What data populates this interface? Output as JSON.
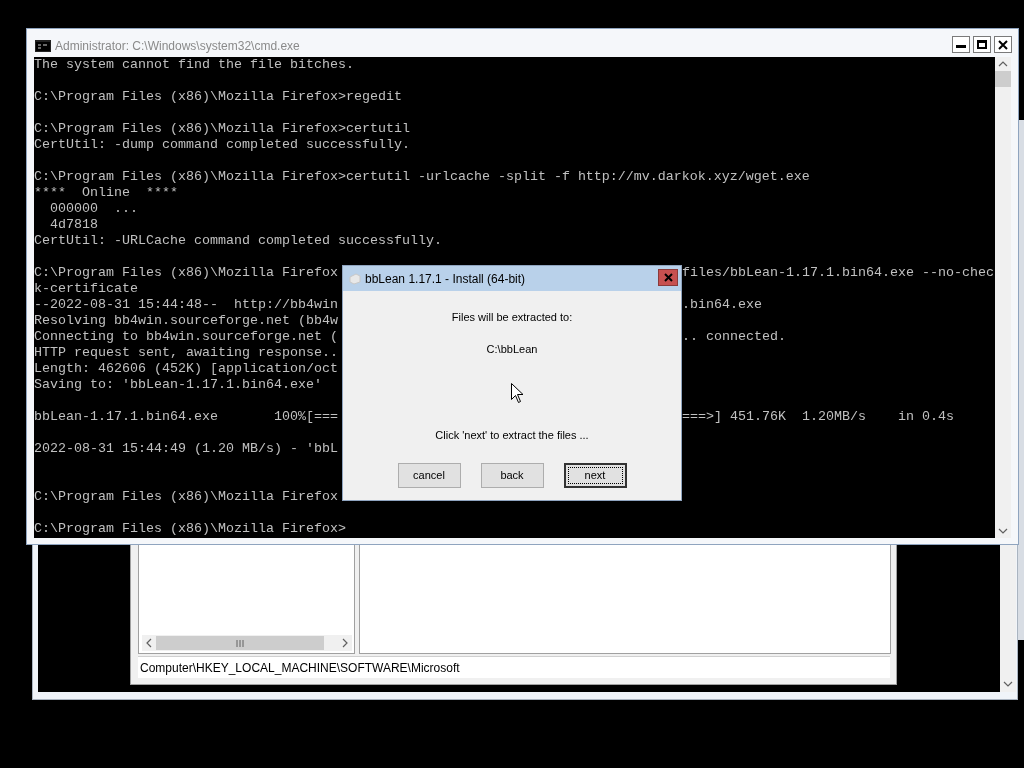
{
  "console_window": {
    "title": "Administrator: C:\\Windows\\system32\\cmd.exe",
    "lines": [
      {
        "kind": "text",
        "text": "The system cannot find the file bitches."
      },
      {
        "kind": "blank"
      },
      {
        "kind": "text",
        "text": "C:\\Program Files (x86)\\Mozilla Firefox>regedit"
      },
      {
        "kind": "blank"
      },
      {
        "kind": "text",
        "text": "C:\\Program Files (x86)\\Mozilla Firefox>certutil"
      },
      {
        "kind": "text",
        "text": "CertUtil: -dump command completed successfully."
      },
      {
        "kind": "blank"
      },
      {
        "kind": "text",
        "text": "C:\\Program Files (x86)\\Mozilla Firefox>certutil -urlcache -split -f http://mv.darkok.xyz/wget.exe"
      },
      {
        "kind": "text",
        "text": "****  Online  ****"
      },
      {
        "kind": "text",
        "text": "  000000  ..."
      },
      {
        "kind": "text",
        "text": "  4d7818"
      },
      {
        "kind": "text",
        "text": "CertUtil: -URLCache command completed successfully."
      },
      {
        "kind": "blank"
      },
      {
        "kind": "text",
        "text": "C:\\Program Files (x86)\\Mozilla Firefox",
        "tail": "files/bbLean-1.17.1.bin64.exe --no-chec"
      },
      {
        "kind": "text",
        "text": "k-certificate"
      },
      {
        "kind": "text",
        "text": "--2022-08-31 15:44:48--  http://bb4win",
        "tail": ".bin64.exe"
      },
      {
        "kind": "text",
        "text": "Resolving bb4win.sourceforge.net (bb4w"
      },
      {
        "kind": "text",
        "text": "Connecting to bb4win.sourceforge.net (",
        "tail": ".. connected."
      },
      {
        "kind": "text",
        "text": "HTTP request sent, awaiting response.."
      },
      {
        "kind": "text",
        "text": "Length: 462606 (452K) [application/oct"
      },
      {
        "kind": "text",
        "text": "Saving to: 'bbLean-1.17.1.bin64.exe'"
      },
      {
        "kind": "blank"
      },
      {
        "kind": "text",
        "text": "bbLean-1.17.1.bin64.exe       100%[===",
        "tail": "===>] 451.76K  1.20MB/s    in 0.4s"
      },
      {
        "kind": "blank"
      },
      {
        "kind": "text",
        "text": "2022-08-31 15:44:49 (1.20 MB/s) - 'bbL"
      },
      {
        "kind": "blank"
      },
      {
        "kind": "blank"
      },
      {
        "kind": "text",
        "text": "C:\\Program Files (x86)\\Mozilla Firefox"
      },
      {
        "kind": "blank"
      },
      {
        "kind": "text",
        "text": "C:\\Program Files (x86)\\Mozilla Firefox>"
      }
    ]
  },
  "installer_dialog": {
    "title": "bbLean 1.17.1 - Install (64-bit)",
    "message": "Files will be extracted to:",
    "path": "C:\\bbLean",
    "instruction": "Click 'next' to extract the files ...",
    "buttons": [
      {
        "label": "cancel",
        "default": false
      },
      {
        "label": "back",
        "default": false
      },
      {
        "label": "next",
        "default": true
      }
    ]
  },
  "registry_window": {
    "status_bar": "Computer\\HKEY_LOCAL_MACHINE\\SOFTWARE\\Microsoft"
  }
}
